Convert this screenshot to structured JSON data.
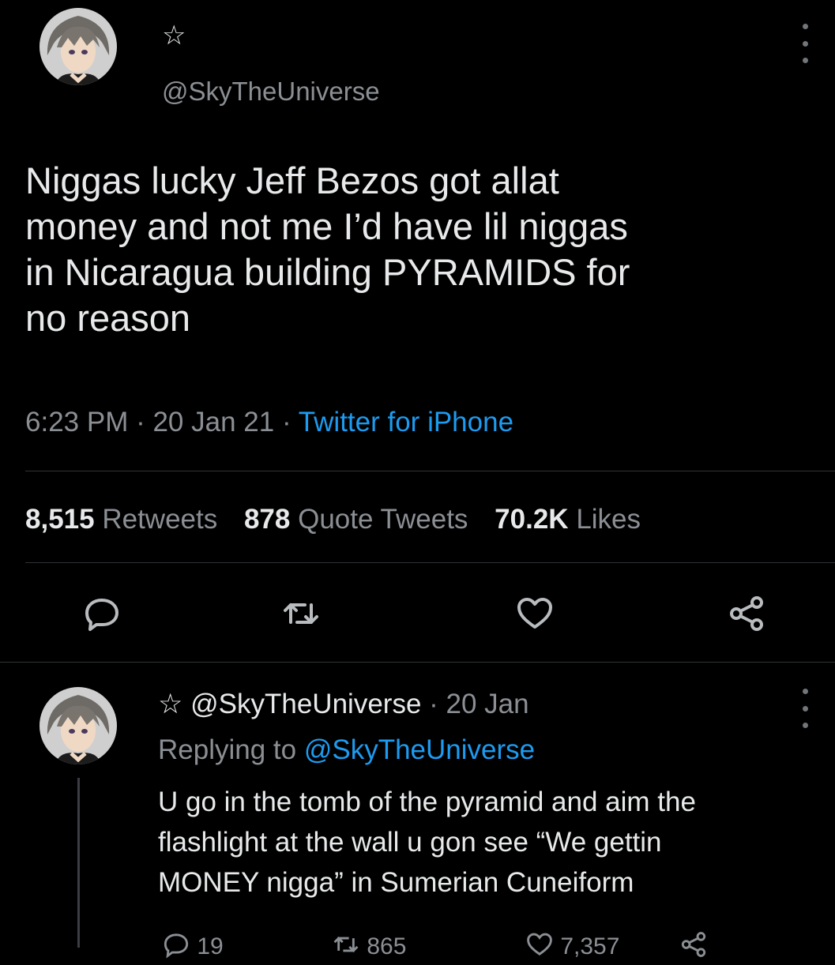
{
  "main_tweet": {
    "star_glyph": "☆",
    "handle": "@SkyTheUniverse",
    "text_lines": [
      "Niggas lucky Jeff Bezos got allat",
      "money and not me I’d have lil niggas",
      "in Nicaragua building PYRAMIDS for",
      "no reason"
    ],
    "time": "6:23 PM",
    "date": "20 Jan 21",
    "separator": " · ",
    "source": "Twitter for iPhone",
    "stats": {
      "retweets_count": "8,515",
      "retweets_label": "Retweets",
      "quotes_count": "878",
      "quotes_label": "Quote Tweets",
      "likes_count": "70.2K",
      "likes_label": "Likes"
    },
    "actions": [
      "reply-icon",
      "retweet-icon",
      "like-icon",
      "share-icon"
    ]
  },
  "reply_tweet": {
    "star_glyph": "☆",
    "handle": "@SkyTheUniverse",
    "separator": " · ",
    "date": "20 Jan",
    "replying_prefix": "Replying to ",
    "replying_to": "@SkyTheUniverse",
    "text_lines": [
      "U go in the tomb of the pyramid and aim the",
      "flashlight at the wall u gon see “We gettin",
      "MONEY nigga” in Sumerian Cuneiform"
    ],
    "reply_count": "19",
    "retweet_count": "865",
    "like_count": "7,357"
  },
  "colors": {
    "background": "#000000",
    "text": "#e7e9ea",
    "muted": "#8b8f94",
    "accent": "#1d9bf0",
    "divider": "#2f3336"
  }
}
